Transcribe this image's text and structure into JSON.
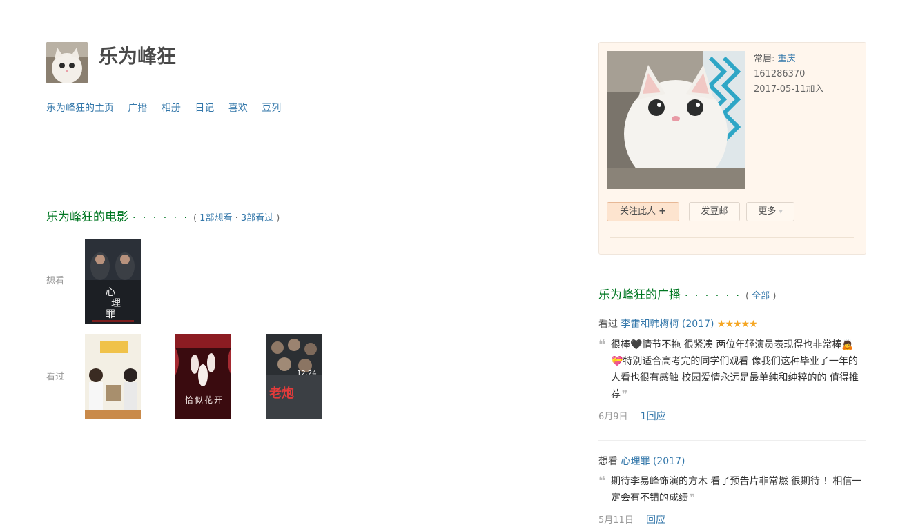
{
  "user": {
    "name": "乐为峰狂"
  },
  "nav": {
    "items": [
      "乐为峰狂的主页",
      "广播",
      "相册",
      "日记",
      "喜欢",
      "豆列"
    ]
  },
  "movies": {
    "title": "乐为峰狂的电影",
    "dots": "· · · · · ·",
    "counts_open": "(",
    "wish_count": "1部想看",
    "sep": "·",
    "done_count": "3部看过",
    "counts_close": ")",
    "wish_label": "想看",
    "done_label": "看过"
  },
  "profile": {
    "residence_label": "常居:",
    "residence_city": "重庆",
    "user_id": "161286370",
    "joined": "2017-05-11加入",
    "follow_label": "关注此人",
    "follow_icon": "+",
    "doumail_label": "发豆邮",
    "more_label": "更多",
    "more_caret": "▾"
  },
  "broadcast": {
    "title": "乐为峰狂的广播",
    "dots": "· · · · · ·",
    "all_open": "(",
    "all_label": "全部",
    "all_close": ")",
    "items": [
      {
        "verb": "看过",
        "movie": "李雷和韩梅梅 (2017)",
        "stars": "★★★★★",
        "quote": "很棒🖤情节不拖 很紧凑 两位年轻演员表现得也非常棒🙇💝特别适合高考完的同学们观看 像我们这种毕业了一年的人看也很有感触 校园爱情永远是最单纯和纯粹的的 值得推荐",
        "date": "6月9日",
        "reply": "1回应"
      },
      {
        "verb": "想看",
        "movie": "心理罪 (2017)",
        "quote": "期待李易峰饰演的方木 看了预告片非常燃 很期待 ！相信一定会有不错的成绩",
        "date": "5月11日",
        "reply": "回应"
      }
    ],
    "quote_open": "❝",
    "quote_close": "❞"
  },
  "colors": {
    "link": "#3377aa",
    "section_title": "#007722",
    "card_bg": "#fff6ed",
    "star": "#f5a623"
  }
}
